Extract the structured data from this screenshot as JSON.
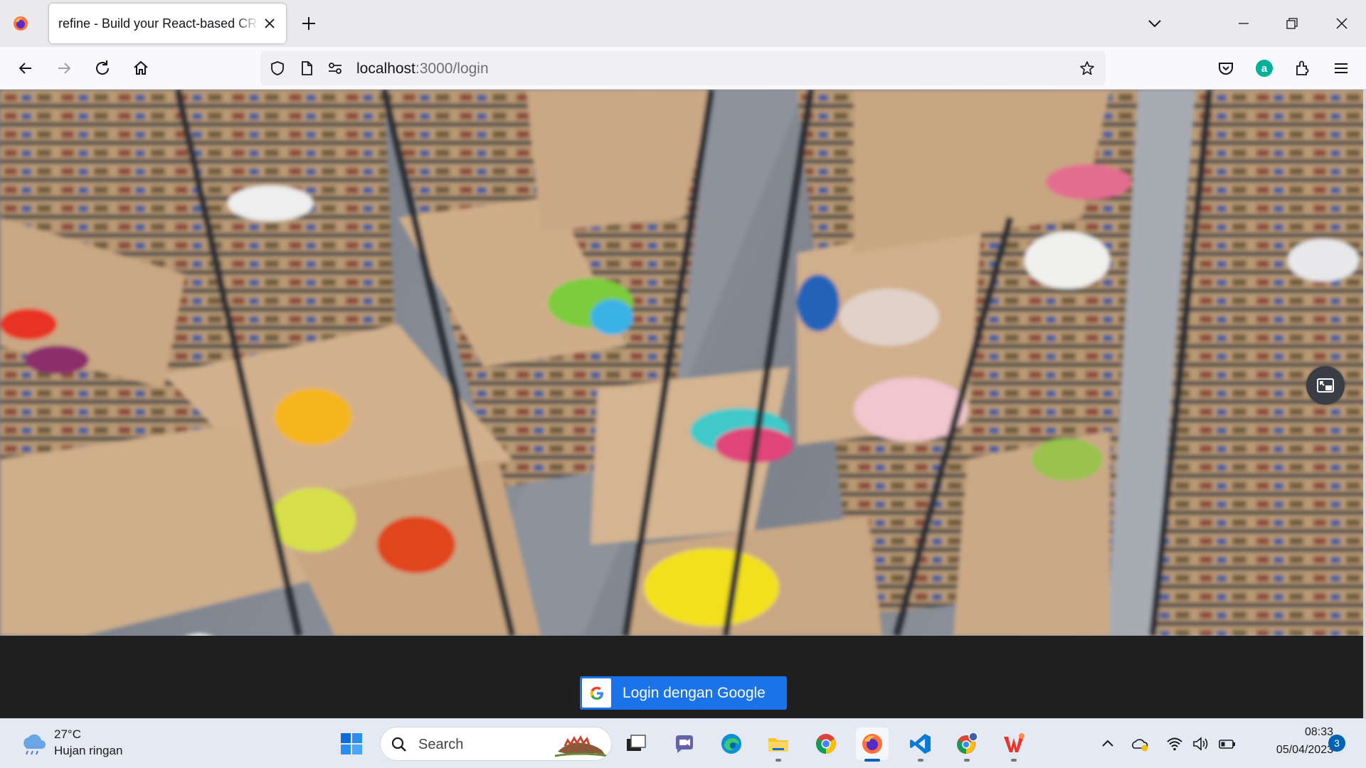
{
  "browser": {
    "tab_title": "refine - Build your React-based CRUD applications, without constraints",
    "url_host": "localhost",
    "url_path": ":3000/login"
  },
  "page": {
    "login_button_label": "Login dengan Google"
  },
  "taskbar": {
    "weather_temp": "27°C",
    "weather_desc": "Hujan ringan",
    "search_placeholder": "Search",
    "time": "08:33",
    "date": "05/04/2023",
    "notification_count": "3"
  },
  "colors": {
    "google_button": "#1a73e8",
    "taskbar_bg": "#e4e9f3",
    "tabstrip_bg": "#eaeaed"
  },
  "icons": {
    "browser": [
      "firefox-logo-icon",
      "close-tab-icon",
      "new-tab-icon",
      "list-all-tabs-icon",
      "minimize-icon",
      "restore-icon",
      "close-window-icon",
      "back-icon",
      "forward-icon",
      "reload-icon",
      "home-icon",
      "shield-icon",
      "page-icon",
      "permissions-icon",
      "bookmark-star-icon",
      "pocket-icon",
      "account-icon",
      "extensions-icon",
      "menu-icon"
    ],
    "taskbar": [
      "weather-icon",
      "windows-start-icon",
      "search-icon",
      "task-view-icon",
      "teams-chat-icon",
      "edge-icon",
      "file-explorer-icon",
      "chrome-icon",
      "firefox-icon",
      "vscode-icon",
      "chrome-profile-icon",
      "wps-office-icon",
      "chevron-up-icon",
      "onedrive-icon",
      "wifi-icon",
      "volume-icon",
      "battery-icon"
    ]
  }
}
